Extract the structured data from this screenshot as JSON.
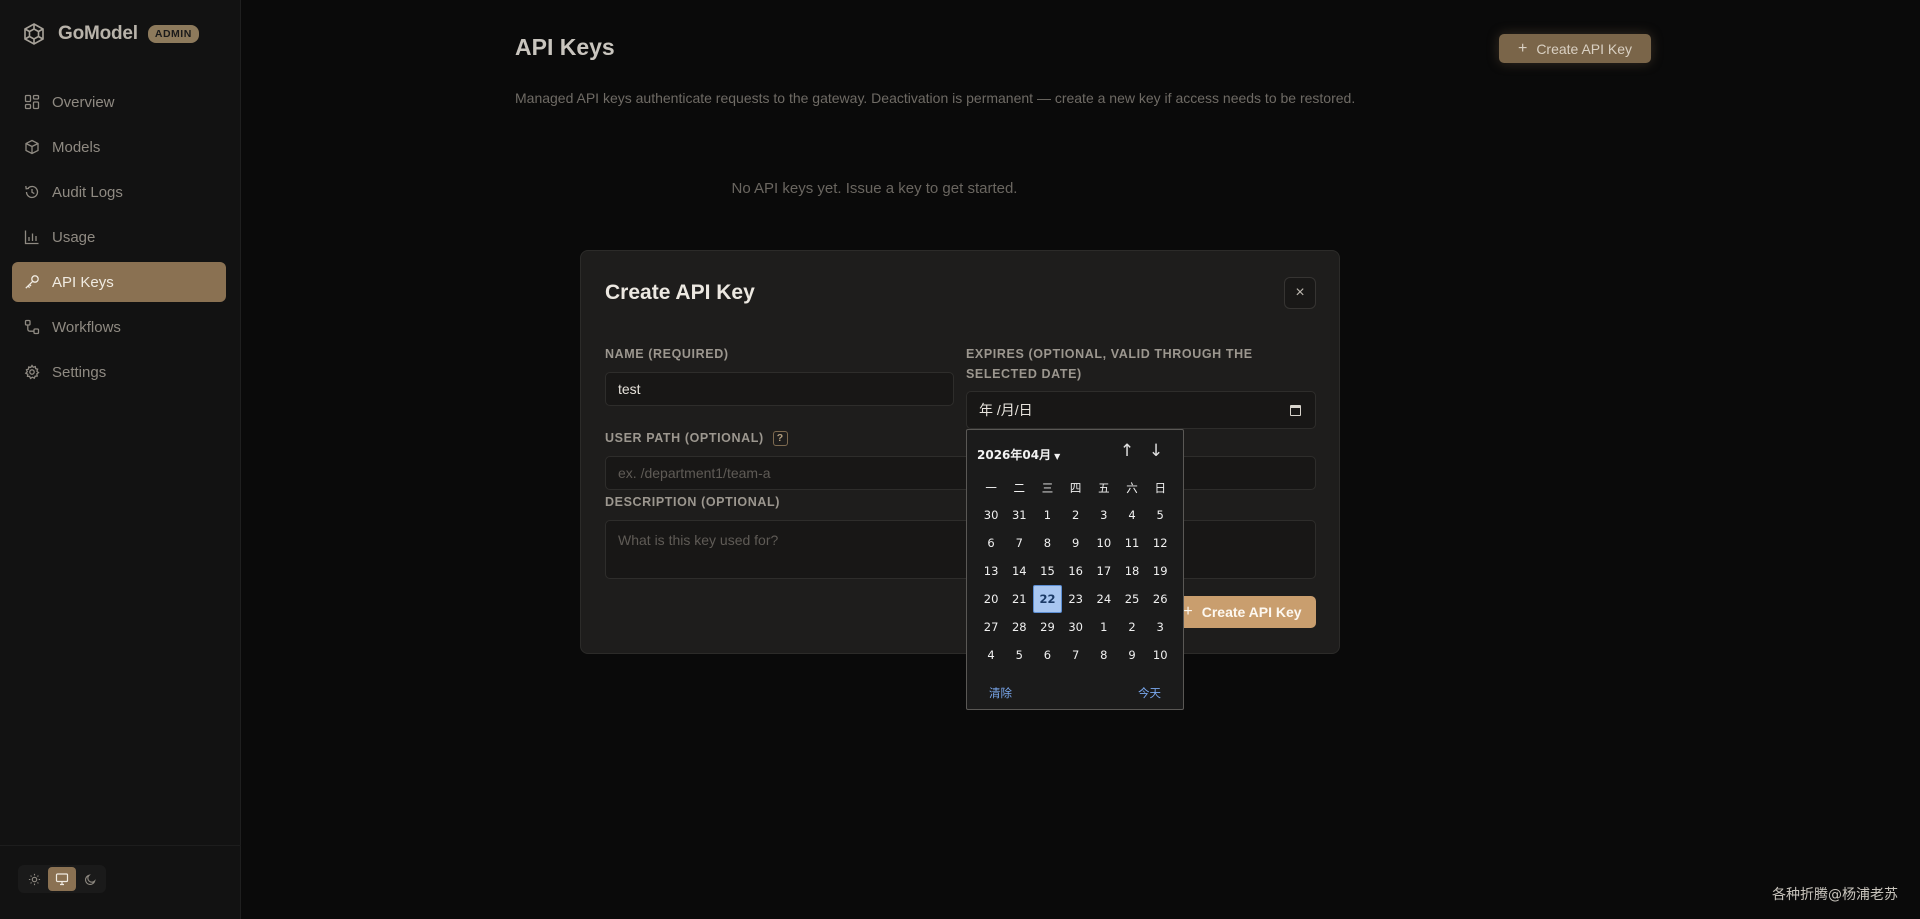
{
  "brand": {
    "name": "GoModel",
    "badge": "ADMIN"
  },
  "sidebar": {
    "items": [
      {
        "label": "Overview",
        "icon": "grid-icon",
        "active": false
      },
      {
        "label": "Models",
        "icon": "cube-icon",
        "active": false
      },
      {
        "label": "Audit Logs",
        "icon": "history-icon",
        "active": false
      },
      {
        "label": "Usage",
        "icon": "bar-chart-icon",
        "active": false
      },
      {
        "label": "API Keys",
        "icon": "key-icon",
        "active": true
      },
      {
        "label": "Workflows",
        "icon": "workflow-icon",
        "active": false
      },
      {
        "label": "Settings",
        "icon": "gear-icon",
        "active": false
      }
    ],
    "theme": {
      "options": [
        "light",
        "system",
        "dark"
      ],
      "selected": "system"
    }
  },
  "page": {
    "title": "API Keys",
    "create_label": "Create API Key",
    "description": "Managed API keys authenticate requests to the gateway. Deactivation is permanent — create a new key if access needs to be restored.",
    "empty_message": "No API keys yet. Issue a key to get started."
  },
  "modal": {
    "title": "Create API Key",
    "close_symbol": "×",
    "name_label": "NAME (REQUIRED)",
    "name_value": "test",
    "expires_label_line1": "EXPIRES (OPTIONAL, VALID THROUGH THE",
    "expires_label_line2": "SELECTED DATE)",
    "expires_placeholder": "年 /月/日",
    "user_path_label": "USER PATH (OPTIONAL)",
    "user_path_help": "?",
    "user_path_placeholder": "ex. /department1/team-a",
    "description_label": "DESCRIPTION (OPTIONAL)",
    "description_placeholder": "What is this key used for?",
    "submit_label": "Create API Key"
  },
  "datepicker": {
    "month_label": "2026年04月",
    "weekdays": [
      "一",
      "二",
      "三",
      "四",
      "五",
      "六",
      "日"
    ],
    "weeks": [
      [
        "30",
        "31",
        "1",
        "2",
        "3",
        "4",
        "5"
      ],
      [
        "6",
        "7",
        "8",
        "9",
        "10",
        "11",
        "12"
      ],
      [
        "13",
        "14",
        "15",
        "16",
        "17",
        "18",
        "19"
      ],
      [
        "20",
        "21",
        "22",
        "23",
        "24",
        "25",
        "26"
      ],
      [
        "27",
        "28",
        "29",
        "30",
        "1",
        "2",
        "3"
      ],
      [
        "4",
        "5",
        "6",
        "7",
        "8",
        "9",
        "10"
      ]
    ],
    "today": "22",
    "clear_label": "清除",
    "today_label": "今天"
  },
  "watermark": "各种折腾@杨浦老苏",
  "colors": {
    "accent": "#8a7152",
    "accent_button": "#c99e6e",
    "background": "#0a0a0a",
    "sidebar": "#121212",
    "modal": "#1e1d1c",
    "today_highlight": "#a8c6f0"
  }
}
